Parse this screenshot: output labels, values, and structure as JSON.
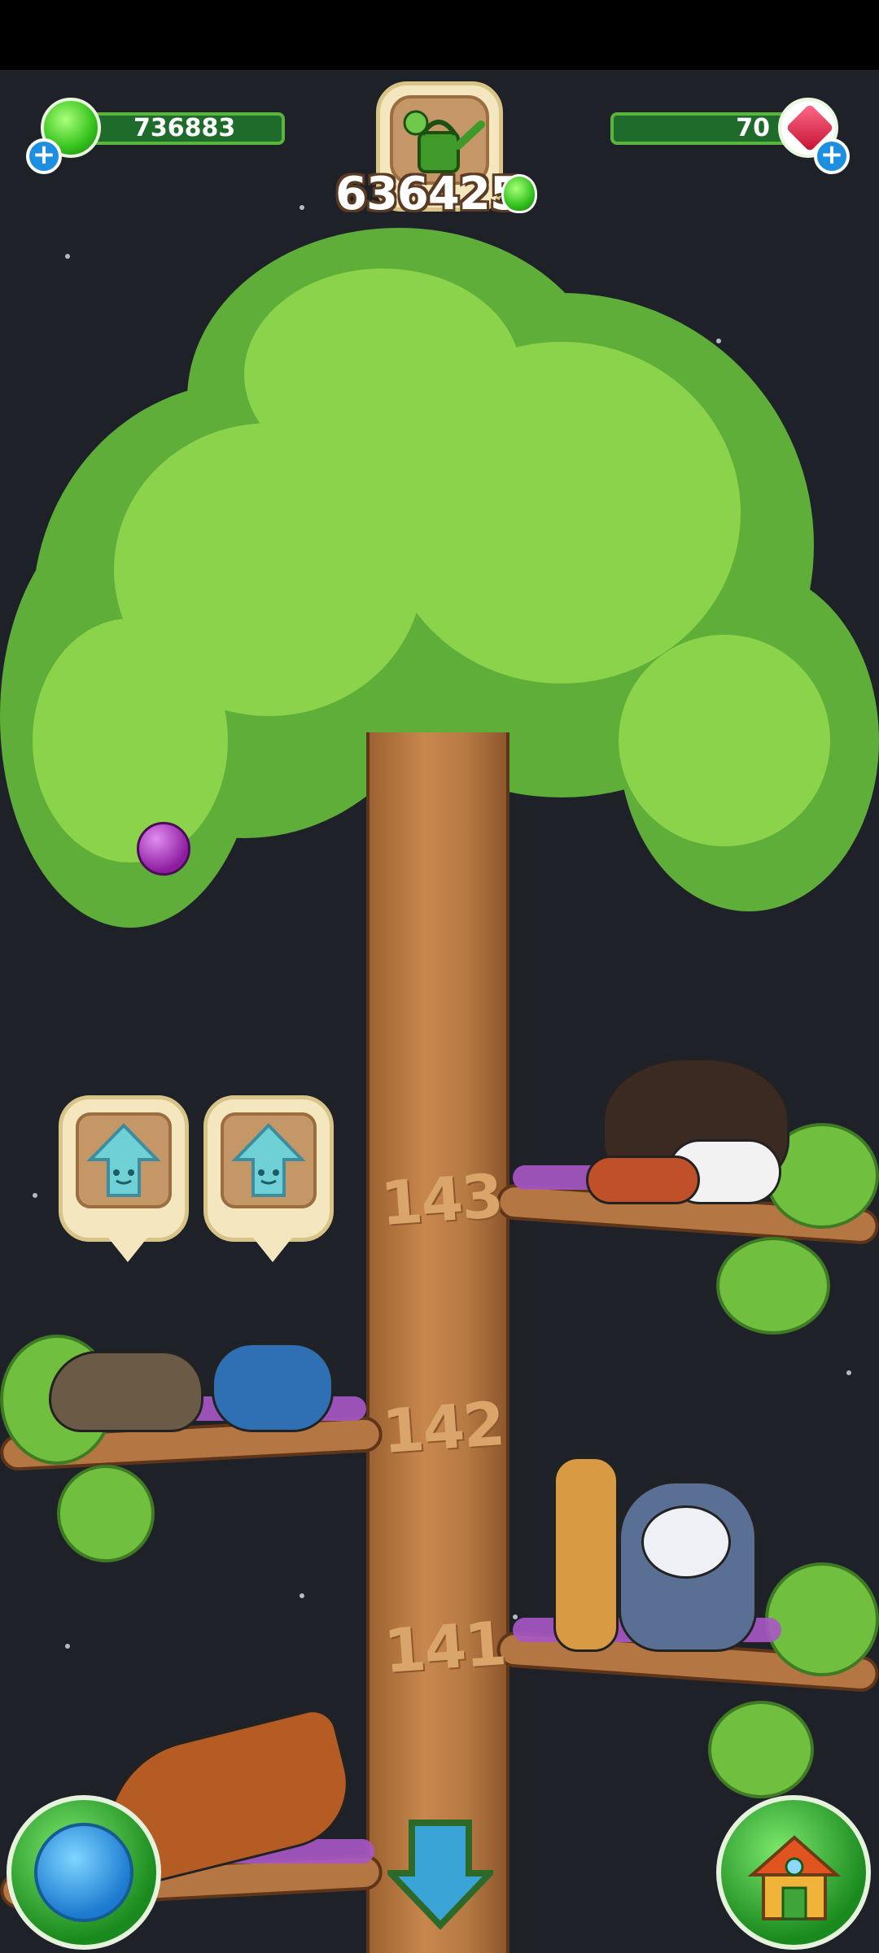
{
  "hud": {
    "green_currency": "736883",
    "red_gems": "70",
    "water_count": "636425"
  },
  "tree": {
    "levels": [
      "143",
      "142",
      "141"
    ]
  },
  "icons": {
    "green_gem": "green-gem-icon",
    "red_gem": "red-gem-icon",
    "plus": "plus-icon",
    "watering_can": "watering-can-icon",
    "upgrade_arrow": "upgrade-arrow-icon",
    "globe": "globe-icon",
    "house": "house-icon",
    "down_arrow": "down-arrow-icon"
  },
  "colors": {
    "background": "#1e2228",
    "bar_green": "#1f6b2c",
    "leaf_green": "#71bf3f",
    "trunk_brown": "#b77a44"
  }
}
